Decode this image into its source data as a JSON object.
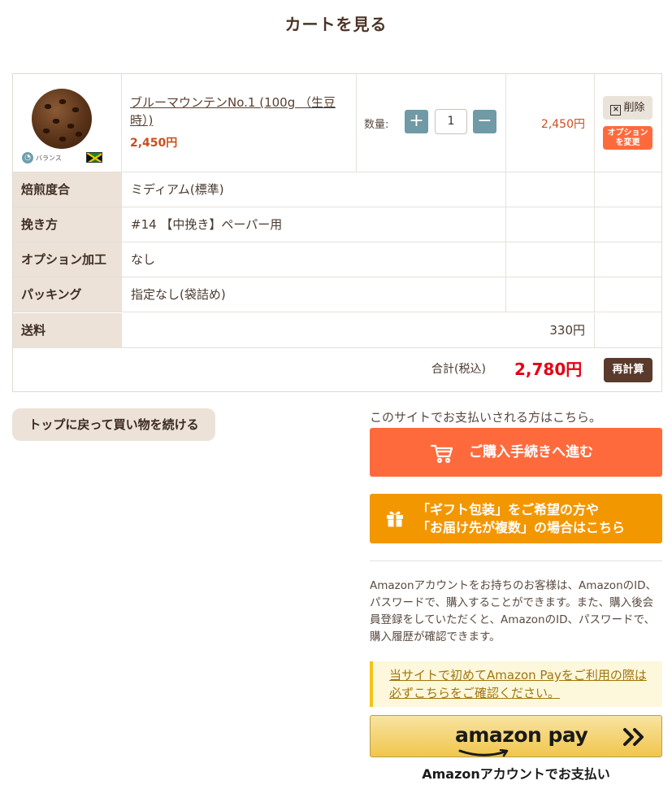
{
  "page": {
    "title": "カートを見る"
  },
  "cart": {
    "product": {
      "name": "ブルーマウンテンNo.1 (100g （生豆時）)",
      "unit_price": "2,450円",
      "badge_label": "バランス",
      "badge_icon": "balance-icon",
      "origin_flag": "jamaica-flag",
      "qty_label": "数量:",
      "qty_value": "1",
      "plus_icon": "+",
      "minus_icon": "−",
      "line_total": "2,450円",
      "delete_label": "削除",
      "option_change_label_1": "オプション",
      "option_change_label_2": "を変更"
    },
    "options": [
      {
        "label": "焙煎度合",
        "value": "ミディアム(標準)"
      },
      {
        "label": "挽き方",
        "value": "#14 【中挽き】ペーパー用"
      },
      {
        "label": "オプション加工",
        "value": "なし"
      },
      {
        "label": "パッキング",
        "value": "指定なし(袋詰め)"
      }
    ],
    "shipping": {
      "label": "送料",
      "value": "330円"
    },
    "total": {
      "label": "合計(税込)",
      "value": "2,780円",
      "recalc_label": "再計算"
    }
  },
  "actions": {
    "continue_shopping": "トップに戻って買い物を続ける",
    "pay_note": "このサイトでお支払いされる方はこちら。",
    "checkout": "ご購入手続きへ進む",
    "gift_line1": "「ギフト包装」をご希望の方や",
    "gift_line2": "「お届け先が複数」の場合はこちら"
  },
  "amazon": {
    "description": "Amazonアカウントをお持ちのお客様は、AmazonのID、パスワードで、購入することができます。また、購入後会員登録をしていただくと、AmazonのID、パスワードで、購入履歴が確認できます。",
    "notice": "当サイトで初めてAmazon Payをご利用の際は必ずこちらをご確認ください。",
    "button_logo": "amazon pay",
    "account_label": "Amazonアカウントでお支払い"
  },
  "colors": {
    "accent_orange": "#ff6a3d",
    "gift_orange": "#f39700",
    "price": "#c8501e",
    "total_red": "#e60012",
    "label_bg": "#ece2d8"
  }
}
